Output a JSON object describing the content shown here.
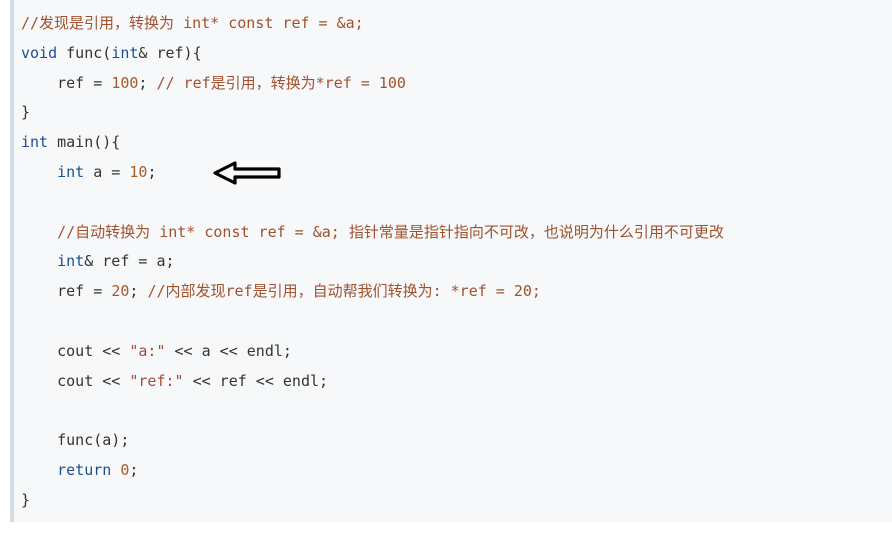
{
  "code": {
    "lines": [
      [
        {
          "t": "//发现是引用，转换为 int* const ref = &a;",
          "c": "cm"
        }
      ],
      [
        {
          "t": "void",
          "c": "kw"
        },
        {
          "t": " func(",
          "c": ""
        },
        {
          "t": "int",
          "c": "kw"
        },
        {
          "t": "& ref){",
          "c": ""
        }
      ],
      [
        {
          "t": "    ref = ",
          "c": ""
        },
        {
          "t": "100",
          "c": "num"
        },
        {
          "t": "; ",
          "c": ""
        },
        {
          "t": "// ref是引用，转换为*ref = 100",
          "c": "cm"
        }
      ],
      [
        {
          "t": "}",
          "c": ""
        }
      ],
      [
        {
          "t": "int",
          "c": "kw"
        },
        {
          "t": " main(){",
          "c": ""
        }
      ],
      [
        {
          "t": "    ",
          "c": ""
        },
        {
          "t": "int",
          "c": "kw"
        },
        {
          "t": " a = ",
          "c": ""
        },
        {
          "t": "10",
          "c": "num"
        },
        {
          "t": ";",
          "c": ""
        }
      ],
      [
        {
          "t": "",
          "c": ""
        }
      ],
      [
        {
          "t": "    ",
          "c": ""
        },
        {
          "t": "//自动转换为 int* const ref = &a; 指针常量是指针指向不可改，也说明为什么引用不可更改",
          "c": "cm"
        }
      ],
      [
        {
          "t": "    ",
          "c": ""
        },
        {
          "t": "int",
          "c": "kw"
        },
        {
          "t": "& ref = a;",
          "c": ""
        }
      ],
      [
        {
          "t": "    ref = ",
          "c": ""
        },
        {
          "t": "20",
          "c": "num"
        },
        {
          "t": "; ",
          "c": ""
        },
        {
          "t": "//内部发现ref是引用，自动帮我们转换为: *ref = 20;",
          "c": "cm"
        }
      ],
      [
        {
          "t": "",
          "c": ""
        }
      ],
      [
        {
          "t": "    cout << ",
          "c": ""
        },
        {
          "t": "\"a:\"",
          "c": "str"
        },
        {
          "t": " << a << endl;",
          "c": ""
        }
      ],
      [
        {
          "t": "    cout << ",
          "c": ""
        },
        {
          "t": "\"ref:\"",
          "c": "str"
        },
        {
          "t": " << ref << endl;",
          "c": ""
        }
      ],
      [
        {
          "t": "",
          "c": ""
        }
      ],
      [
        {
          "t": "    func(a);",
          "c": ""
        }
      ],
      [
        {
          "t": "    ",
          "c": ""
        },
        {
          "t": "return",
          "c": "kw"
        },
        {
          "t": " ",
          "c": ""
        },
        {
          "t": "0",
          "c": "num"
        },
        {
          "t": ";",
          "c": ""
        }
      ],
      [
        {
          "t": "}",
          "c": ""
        }
      ]
    ]
  },
  "annotation": {
    "icon": "left-arrow-icon",
    "color": "#000000"
  }
}
